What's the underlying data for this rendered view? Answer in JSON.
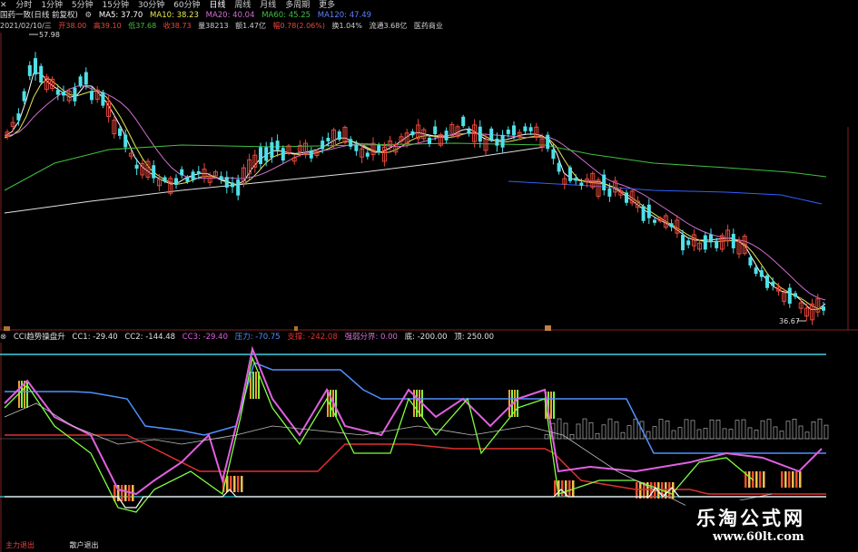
{
  "toolbar": {
    "items": [
      "分时",
      "1分钟",
      "5分钟",
      "15分钟",
      "30分钟",
      "60分钟",
      "日线",
      "周线",
      "月线",
      "多周期",
      "更多"
    ],
    "selected_index": 6
  },
  "info_line1": {
    "stock_name": "国药一致(日线 前复权)",
    "ma5": "MA5: 37.70",
    "ma10": "MA10: 38.23",
    "ma20": "MA20: 40.04",
    "ma60": "MA60: 45.25",
    "ma120": "MA120: 47.49"
  },
  "info_line2": {
    "date": "2021/02/10/三",
    "open": "开38.00",
    "high": "高39.10",
    "low": "低37.68",
    "close": "收38.73",
    "volume": "量38213",
    "amount": "额1.47亿",
    "change": "幅0.78(2.06%)",
    "turnover": "换1.04%",
    "float": "流通3.68亿",
    "industry": "医药商业"
  },
  "price_labels": {
    "high": "57.98",
    "low": "36.67"
  },
  "cci": {
    "title": "CCI趋势操盘升",
    "cc1": "CC1: -29.40",
    "cc2": "CC2: -144.48",
    "cc3": "CC3: -29.40",
    "pressure": "压力: -70.75",
    "support": "支撑: -242.08",
    "trend_line": "强弱分界: 0.00",
    "bottom": "底: -200.00",
    "top": "顶: 250.00"
  },
  "bottom_labels": {
    "main_exit": "主力退出",
    "retail_exit": "散户退出"
  },
  "watermark": {
    "cn": "乐淘公式网",
    "url": "www.60lt.com"
  },
  "colors": {
    "up": "#e8483c",
    "down": "#4fe0e8",
    "ma5": "#ffffff",
    "ma10": "#e8e850",
    "ma20": "#d070d0",
    "ma60": "#40c040",
    "ma120": "#3060ff",
    "ma250": "#e0e0e0",
    "cc1": "#e060e0",
    "cc2": "#80ff40",
    "pressure": "#5090ff",
    "support": "#e03030",
    "ref": "#40d0e0"
  },
  "icons": {
    "close": "close-icon",
    "settings": "gear-icon"
  }
}
